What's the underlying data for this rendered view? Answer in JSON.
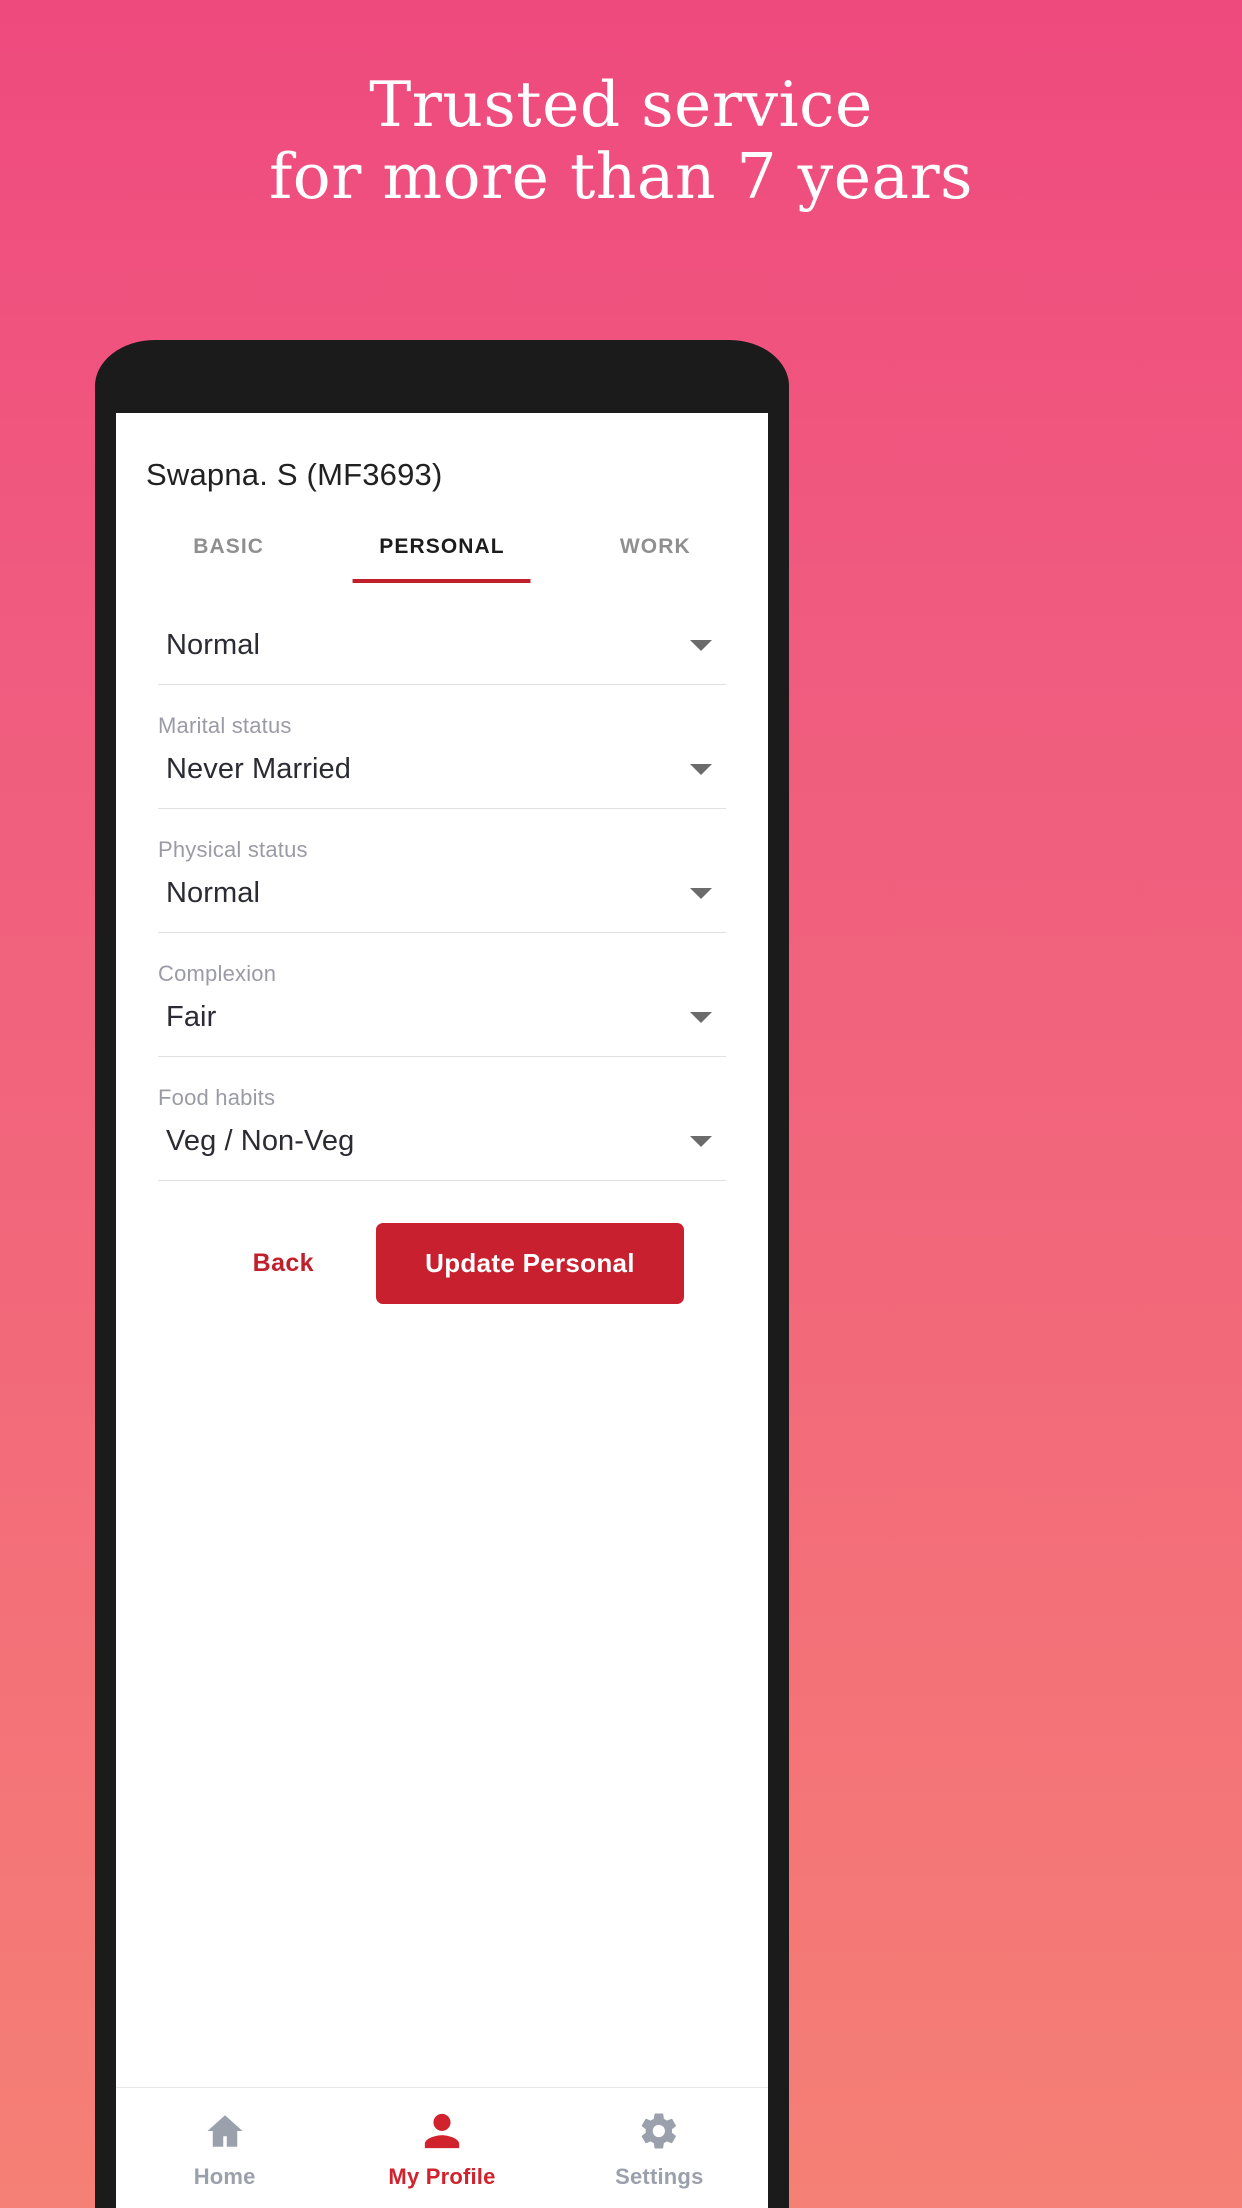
{
  "promo": {
    "line1": "Trusted service",
    "line2": "for more than 7 years"
  },
  "colors": {
    "background_top": "#ef4a7e",
    "background_bottom": "#f58075",
    "accent_red": "#c8202f",
    "tab_underline": "#c0202c",
    "nav_inactive": "#9aa0ac",
    "phone_bezel": "#1b1b1b"
  },
  "app": {
    "profile_title": "Swapna. S (MF3693)",
    "tabs": [
      {
        "label": "BASIC",
        "active": false
      },
      {
        "label": "PERSONAL",
        "active": true
      },
      {
        "label": "WORK",
        "active": false
      }
    ],
    "fields": [
      {
        "label": "",
        "value": "Normal",
        "icon": "chevron-down-icon"
      },
      {
        "label": "Marital status",
        "value": "Never Married",
        "icon": "chevron-down-icon"
      },
      {
        "label": "Physical status",
        "value": "Normal",
        "icon": "chevron-down-icon"
      },
      {
        "label": "Complexion",
        "value": "Fair",
        "icon": "chevron-down-icon"
      },
      {
        "label": "Food habits",
        "value": "Veg / Non-Veg",
        "icon": "chevron-down-icon"
      }
    ],
    "actions": {
      "back_label": "Back",
      "submit_label": "Update Personal"
    },
    "bottom_nav": [
      {
        "label": "Home",
        "icon": "home-icon",
        "active": false
      },
      {
        "label": "My Profile",
        "icon": "person-icon",
        "active": true
      },
      {
        "label": "Settings",
        "icon": "gear-icon",
        "active": false
      }
    ]
  }
}
